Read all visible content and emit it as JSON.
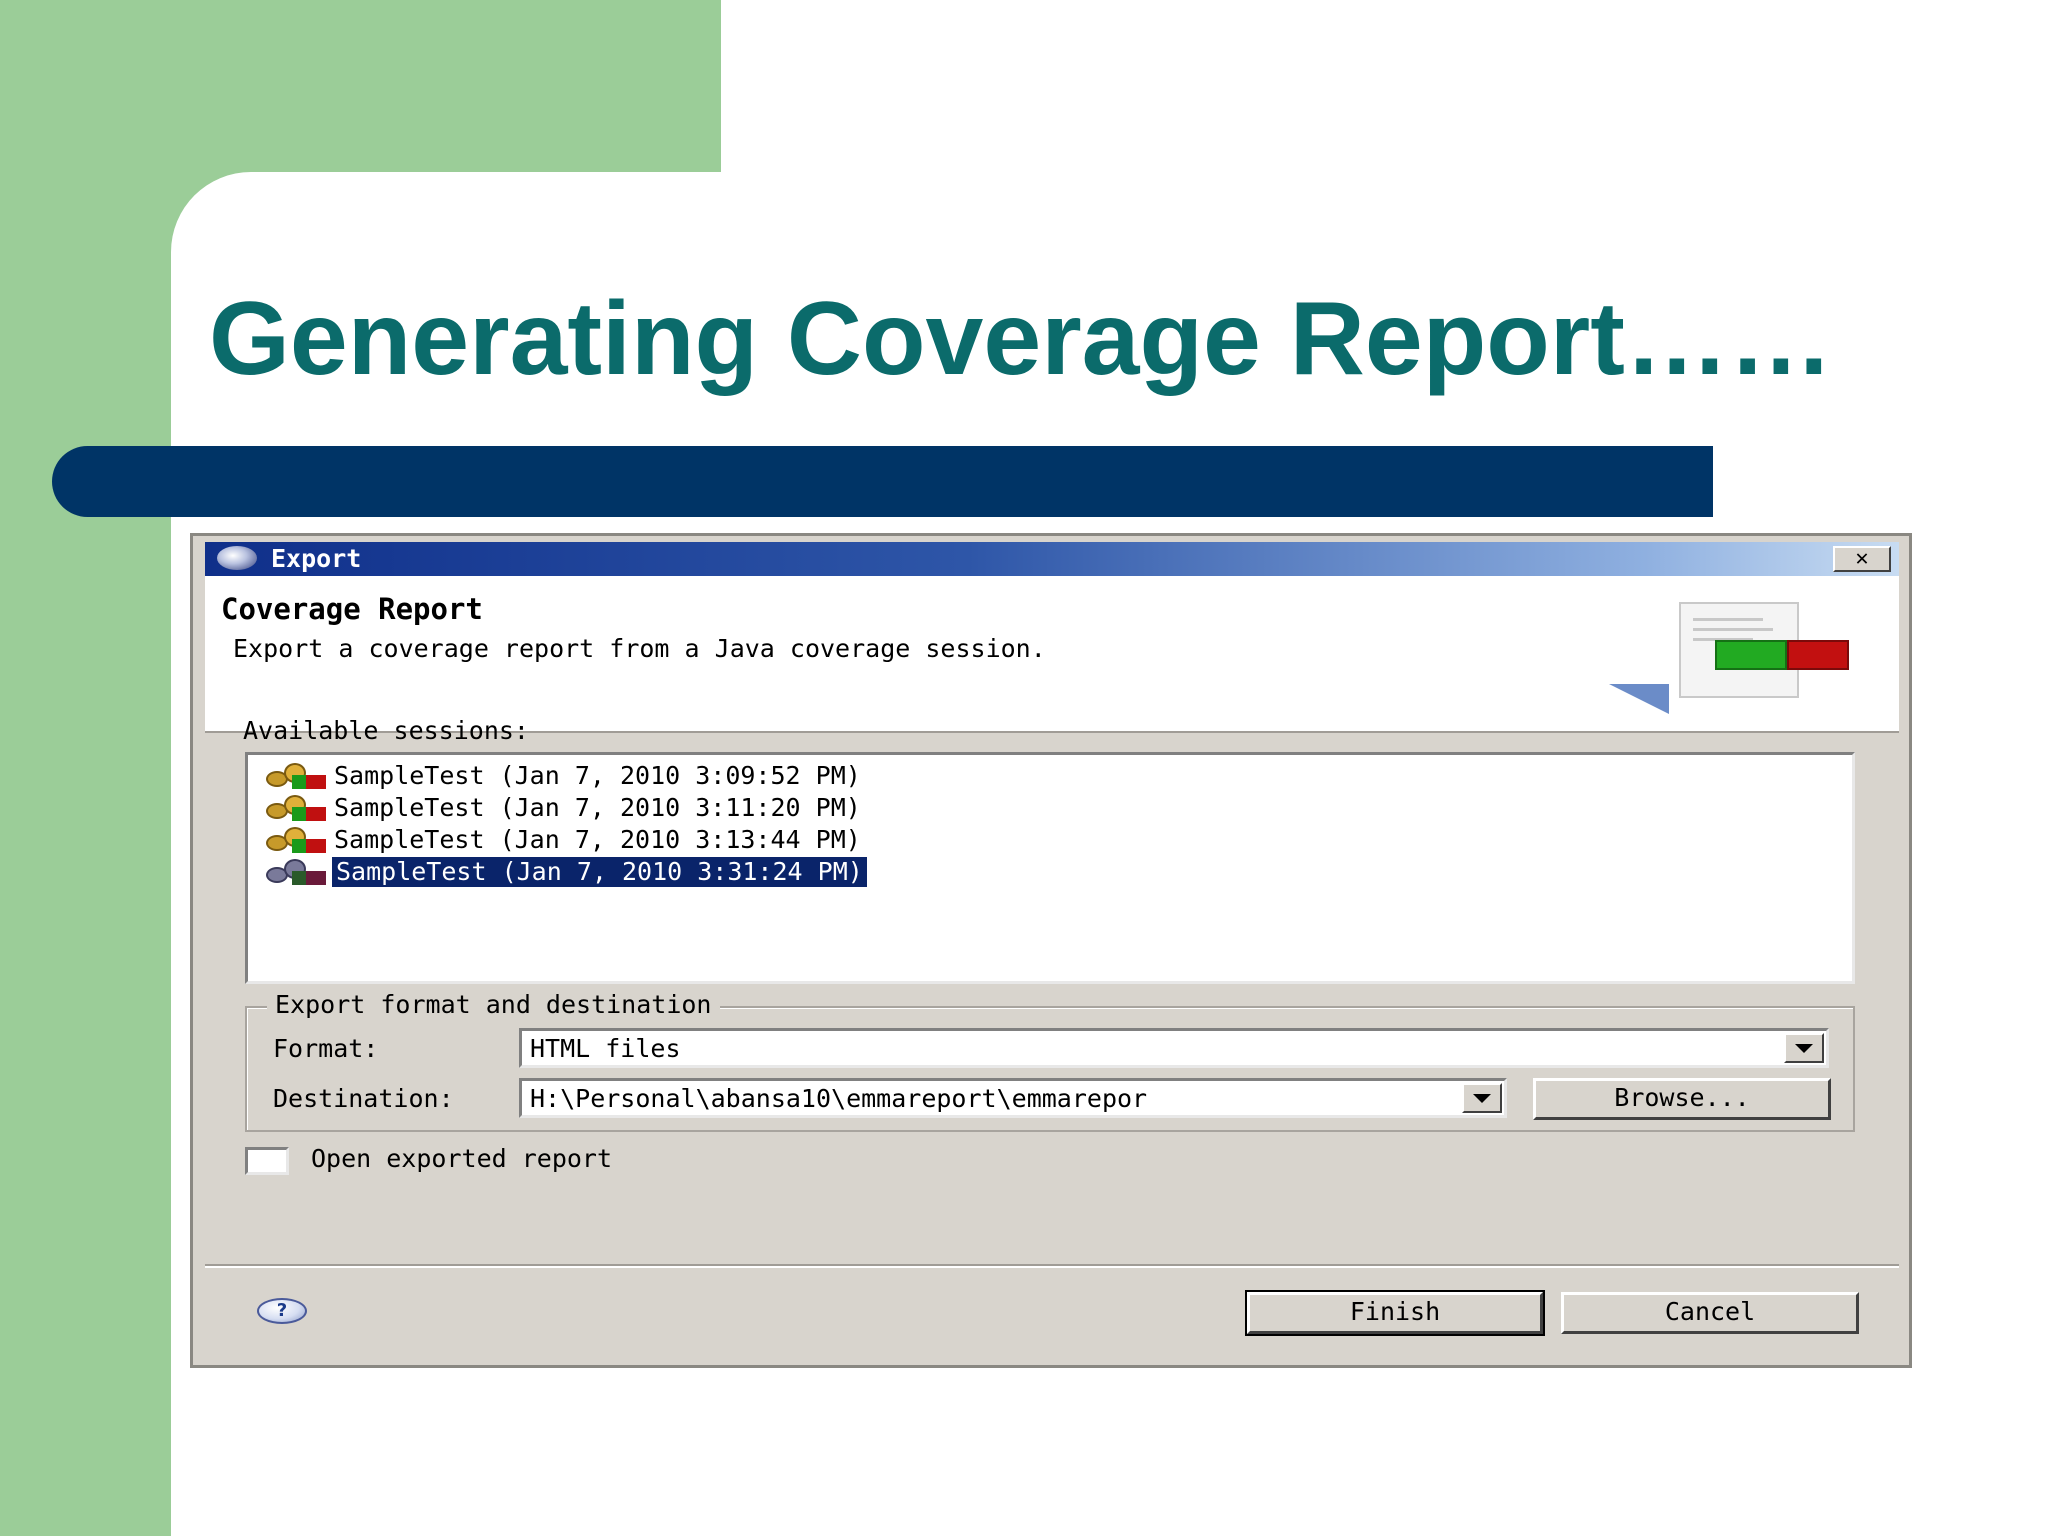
{
  "slide": {
    "title": "Generating Coverage Report……"
  },
  "dialog": {
    "window_title": "Export",
    "close_label": "✕",
    "header": {
      "title": "Coverage Report",
      "description": "Export a coverage report from a Java coverage session."
    },
    "sessions_label": "Available sessions:",
    "sessions": [
      {
        "label": "SampleTest (Jan 7, 2010 3:09:52 PM)",
        "selected": false
      },
      {
        "label": "SampleTest (Jan 7, 2010 3:11:20 PM)",
        "selected": false
      },
      {
        "label": "SampleTest (Jan 7, 2010 3:13:44 PM)",
        "selected": false
      },
      {
        "label": "SampleTest (Jan 7, 2010 3:31:24 PM)",
        "selected": true
      }
    ],
    "export_group": {
      "legend": "Export format and destination",
      "format_label": "Format:",
      "format_value": "HTML files",
      "destination_label": "Destination:",
      "destination_value": "H:\\Personal\\abansa10\\emmareport\\emmarepor",
      "browse_label": "Browse..."
    },
    "open_report": {
      "label": "Open exported report",
      "checked": false
    },
    "help_label": "?",
    "finish_label": "Finish",
    "cancel_label": "Cancel"
  },
  "colors": {
    "title_text": "#0b6b6b",
    "title_bar": "#003466",
    "slide_green": "#9bcd98",
    "selection": "#0a246a"
  },
  "icons": [
    "export-window-icon",
    "close-icon",
    "coverage-report-graphic",
    "session-icon",
    "help-icon",
    "dropdown-arrow-icon"
  ]
}
